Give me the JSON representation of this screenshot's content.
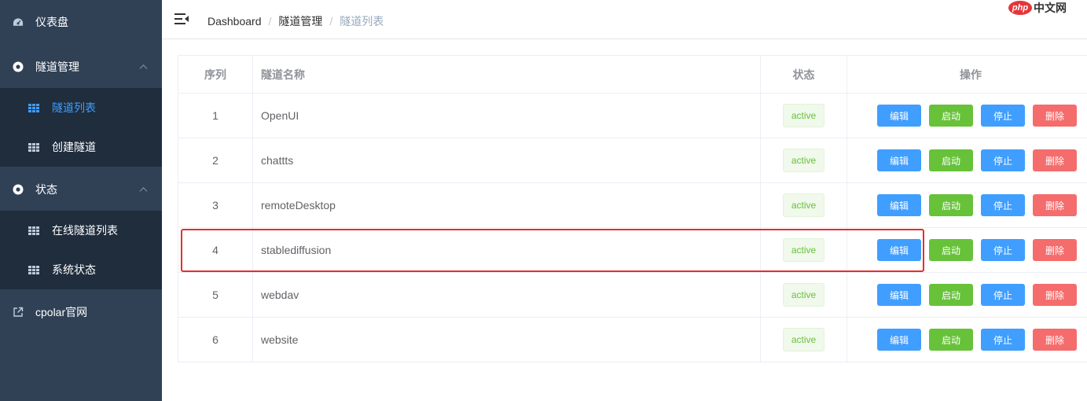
{
  "sidebar": {
    "dashboard": "仪表盘",
    "tunnel_mgmt": "隧道管理",
    "tunnel_list": "隧道列表",
    "create_tunnel": "创建隧道",
    "status": "状态",
    "online_list": "在线隧道列表",
    "system_status": "系统状态",
    "cpolar_site": "cpolar官网",
    "active_color": "#409eff",
    "bg_color": "#304156"
  },
  "breadcrumb": [
    "Dashboard",
    "隧道管理",
    "隧道列表"
  ],
  "watermark": {
    "php": "php",
    "cn": "中文网"
  },
  "table": {
    "headers": [
      "序列",
      "隧道名称",
      "状态",
      "操作"
    ],
    "actions": {
      "edit": "编辑",
      "start": "启动",
      "stop": "停止",
      "delete": "删除"
    },
    "rows": [
      {
        "index": "1",
        "name": "OpenUI",
        "status": "active"
      },
      {
        "index": "2",
        "name": "chattts",
        "status": "active"
      },
      {
        "index": "3",
        "name": "remoteDesktop",
        "status": "active"
      },
      {
        "index": "4",
        "name": "stablediffusion",
        "status": "active"
      },
      {
        "index": "5",
        "name": "webdav",
        "status": "active"
      },
      {
        "index": "6",
        "name": "website",
        "status": "active"
      }
    ]
  },
  "highlight": {
    "color": "#e52e2e",
    "row_index": "4"
  }
}
